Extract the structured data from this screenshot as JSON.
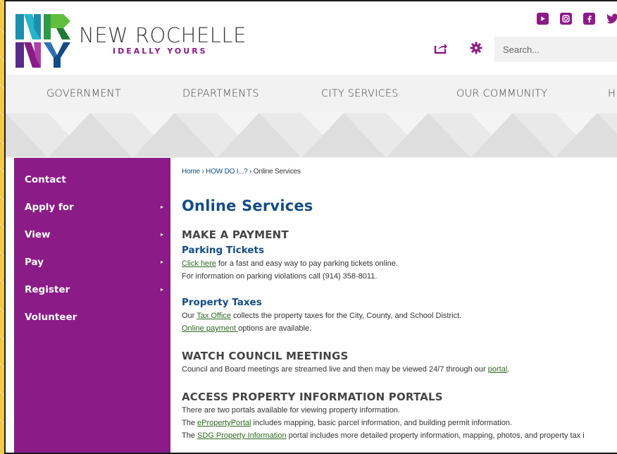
{
  "brand": {
    "name": "NEW ROCHELLE",
    "tagline": "IDEALLY YOURS",
    "colors": {
      "purple": "#8b1b87",
      "blue": "#134c85",
      "green": "#2f9b46",
      "teal": "#1a8fb0"
    }
  },
  "social": [
    "youtube-icon",
    "instagram-icon",
    "facebook-icon",
    "twitter-icon"
  ],
  "search": {
    "placeholder": "Search..."
  },
  "nav": {
    "items": [
      "GOVERNMENT",
      "DEPARTMENTS",
      "CITY SERVICES",
      "OUR COMMUNITY",
      "H"
    ]
  },
  "sidebar": {
    "items": [
      {
        "label": "Contact",
        "has_submenu": false
      },
      {
        "label": "Apply for",
        "has_submenu": true,
        "arrow": "▸"
      },
      {
        "label": "View",
        "has_submenu": true,
        "arrow": "▸"
      },
      {
        "label": "Pay",
        "has_submenu": true,
        "arrow": "▸"
      },
      {
        "label": "Register",
        "has_submenu": true,
        "arrow": "▸"
      },
      {
        "label": "Volunteer",
        "has_submenu": false
      }
    ]
  },
  "breadcrumb": {
    "home": "Home",
    "sep1": " › ",
    "parent": "HOW DO I...?",
    "sep2": " › ",
    "current": "Online Services"
  },
  "page": {
    "title": "Online Services",
    "sections": {
      "payment": {
        "heading": "MAKE A PAYMENT",
        "parking": {
          "title": "Parking Tickets",
          "link": "Click here",
          "text1": " for a fast and easy way to pay parking tickets online.",
          "text2": "For information on parking violations call (914) 358-8011."
        },
        "tax": {
          "title": "Property Taxes",
          "pre": "Our ",
          "link": "Tax Office",
          "post": " collects the property taxes for the City, County, and School District.",
          "link2": "Online payment ",
          "post2": "options are available."
        }
      },
      "council": {
        "heading": "WATCH COUNCIL MEETINGS",
        "text": "Council and Board meetings are streamed live and then may be viewed 24/7 through our ",
        "link": "portal",
        "end": "."
      },
      "property": {
        "heading": "ACCESS PROPERTY INFORMATION PORTALS",
        "intro": "There are two portals available for viewing property information.",
        "l1_pre": "The ",
        "l1_link": "ePropertyPortal",
        "l1_post": " includes mapping, basic parcel information, and building permit information.",
        "l2_pre": "The ",
        "l2_link": "SDG Property Information",
        "l2_post": " portal includes more detailed property information, mapping, photos, and property tax i"
      }
    }
  }
}
